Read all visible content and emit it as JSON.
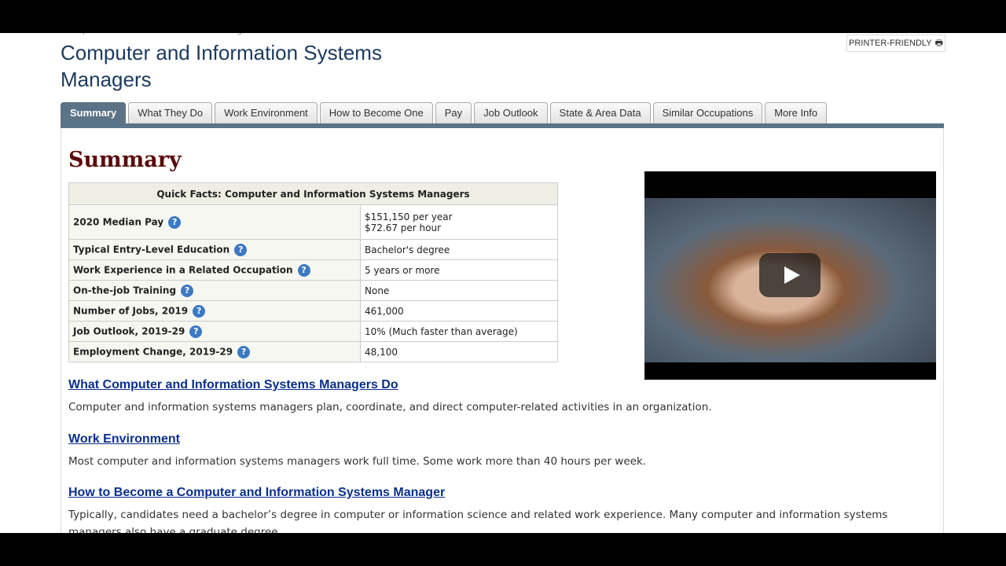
{
  "breadcrumb": "Occupational Outlook Handbook > Management >",
  "title": "Computer and Information Systems Managers",
  "printer_label": "PRINTER-FRIENDLY",
  "tabs": [
    "Summary",
    "What They Do",
    "Work Environment",
    "How to Become One",
    "Pay",
    "Job Outlook",
    "State & Area Data",
    "Similar Occupations",
    "More Info"
  ],
  "summary_heading": "Summary",
  "quick_facts": {
    "header": "Quick Facts: Computer and Information Systems Managers",
    "rows": [
      {
        "label": "2020 Median Pay",
        "value": "$151,150 per year",
        "value2": "$72.67 per hour"
      },
      {
        "label": "Typical Entry-Level Education",
        "value": "Bachelor's degree"
      },
      {
        "label": "Work Experience in a Related Occupation",
        "value": "5 years or more"
      },
      {
        "label": "On-the-job Training",
        "value": "None"
      },
      {
        "label": "Number of Jobs, 2019",
        "value": "461,000"
      },
      {
        "label": "Job Outlook, 2019-29",
        "value": "10% (Much faster than average)"
      },
      {
        "label": "Employment Change, 2019-29",
        "value": "48,100"
      }
    ]
  },
  "sections": [
    {
      "link": "What Computer and Information Systems Managers Do",
      "text": "Computer and information systems managers plan, coordinate, and direct computer-related activities in an organization."
    },
    {
      "link": "Work Environment",
      "text": "Most computer and information systems managers work full time. Some work more than 40 hours per week."
    },
    {
      "link": "How to Become a Computer and Information Systems Manager",
      "text": "Typically, candidates need a bachelor’s degree in computer or information science and related work experience. Many computer and information systems managers also have a graduate degree."
    }
  ],
  "icons": {
    "printer": "printer-icon",
    "help": "question-icon",
    "play": "play-icon"
  }
}
